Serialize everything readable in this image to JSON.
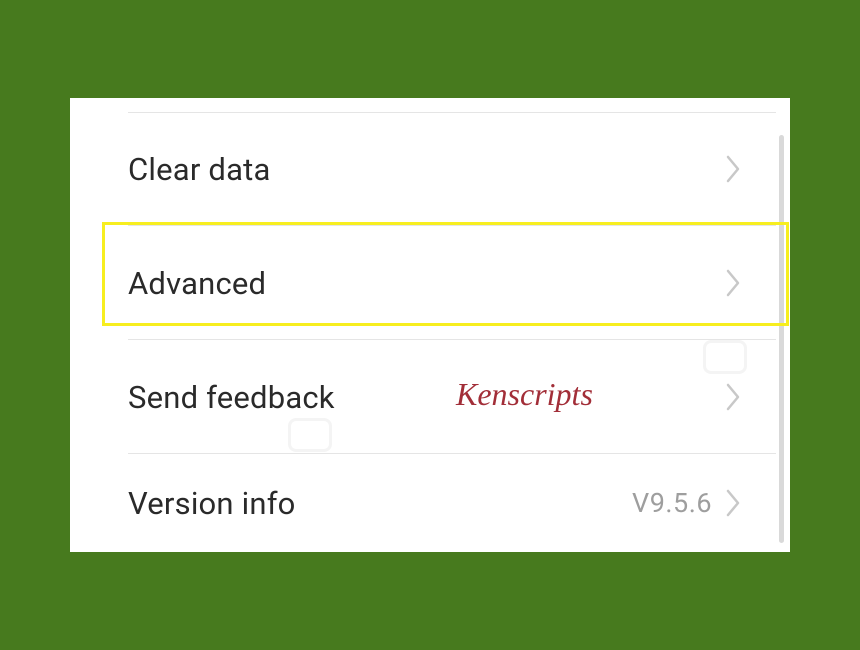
{
  "settings": {
    "items": [
      {
        "label": "Clear data",
        "value": null
      },
      {
        "label": "Advanced",
        "value": null
      },
      {
        "label": "Send feedback",
        "value": null
      },
      {
        "label": "Version info",
        "value": "V9.5.6"
      }
    ]
  },
  "watermark": "Kenscripts"
}
